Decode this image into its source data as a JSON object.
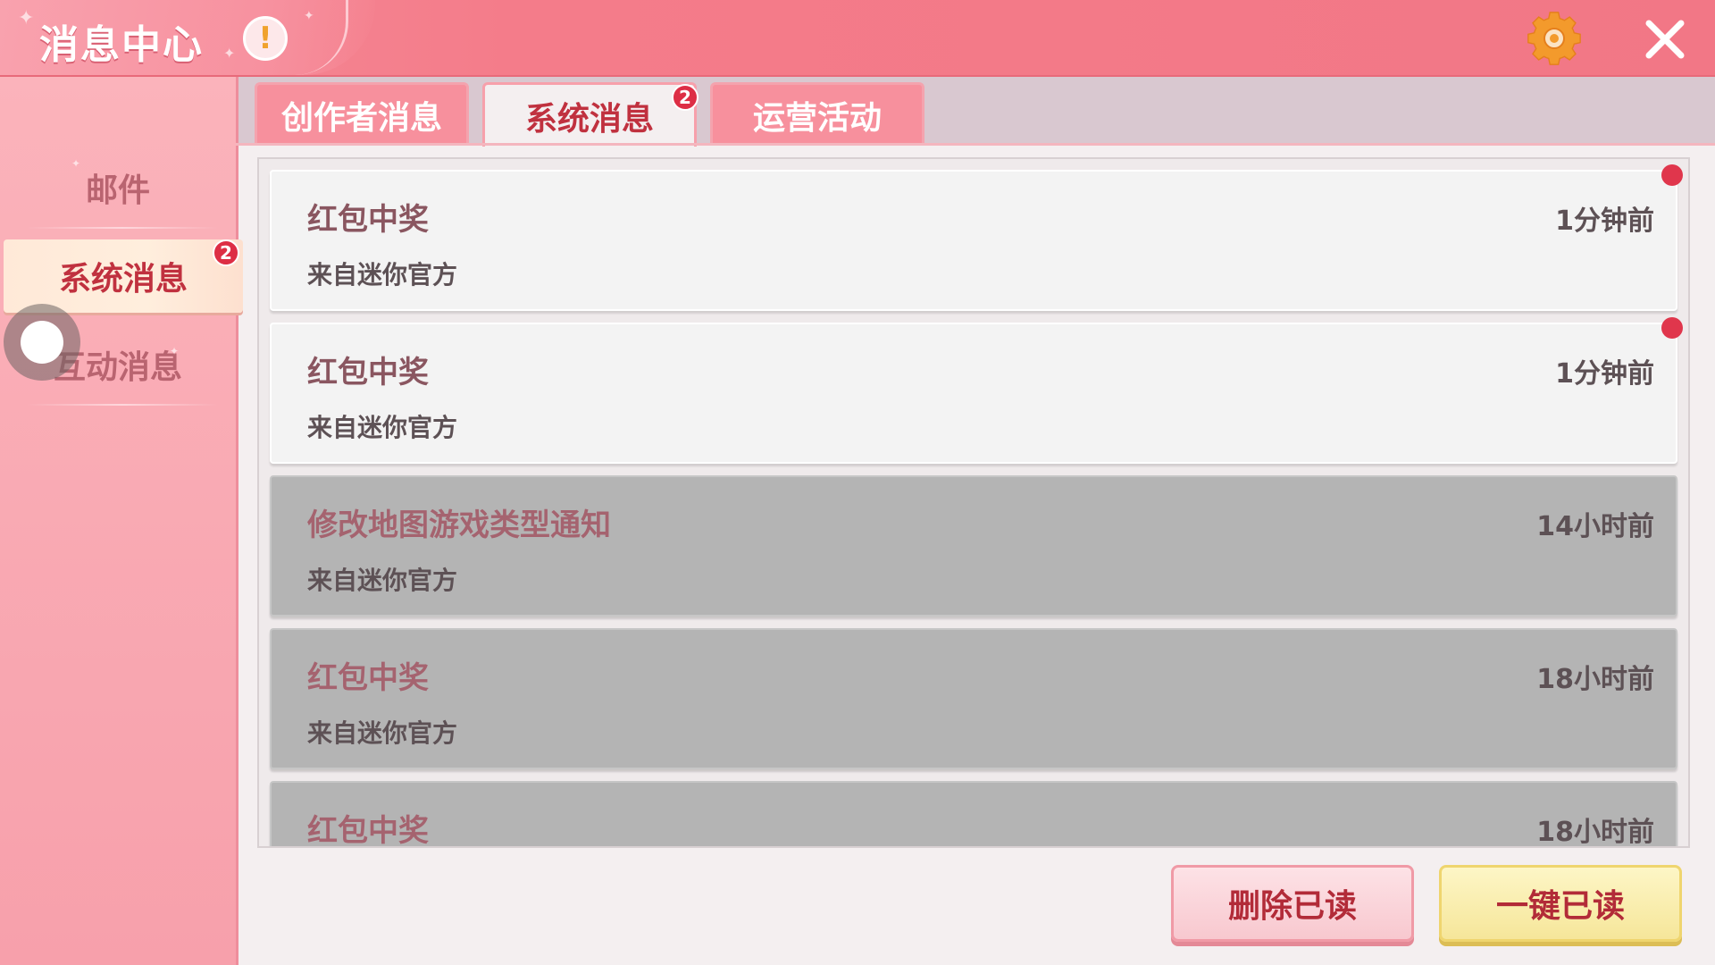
{
  "header": {
    "title": "消息中心",
    "warning_icon": "exclamation-icon",
    "settings_icon": "gear-icon",
    "close_icon": "close-icon"
  },
  "sidebar": {
    "items": [
      {
        "label": "邮件",
        "active": false
      },
      {
        "label": "系统消息",
        "active": true,
        "badge": "2"
      },
      {
        "label": "互动消息",
        "active": false
      }
    ]
  },
  "tabs": [
    {
      "label": "创作者消息",
      "active": false
    },
    {
      "label": "系统消息",
      "active": true,
      "badge": "2"
    },
    {
      "label": "运营活动",
      "active": false
    }
  ],
  "messages": [
    {
      "title": "红包中奖",
      "from": "来自迷你官方",
      "time": "1分钟前",
      "unread": true
    },
    {
      "title": "红包中奖",
      "from": "来自迷你官方",
      "time": "1分钟前",
      "unread": true
    },
    {
      "title": "修改地图游戏类型通知",
      "from": "来自迷你官方",
      "time": "14小时前",
      "unread": false
    },
    {
      "title": "红包中奖",
      "from": "来自迷你官方",
      "time": "18小时前",
      "unread": false
    },
    {
      "title": "红包中奖",
      "from": "",
      "time": "18小时前",
      "unread": false
    }
  ],
  "buttons": {
    "delete_read": "删除已读",
    "mark_all_read": "一键已读"
  },
  "colors": {
    "header": "#f47c8a",
    "sidebar": "#f7a0ab",
    "accent_text": "#c0313f",
    "badge": "#dd2e45",
    "unread_dot": "#e0364c"
  }
}
